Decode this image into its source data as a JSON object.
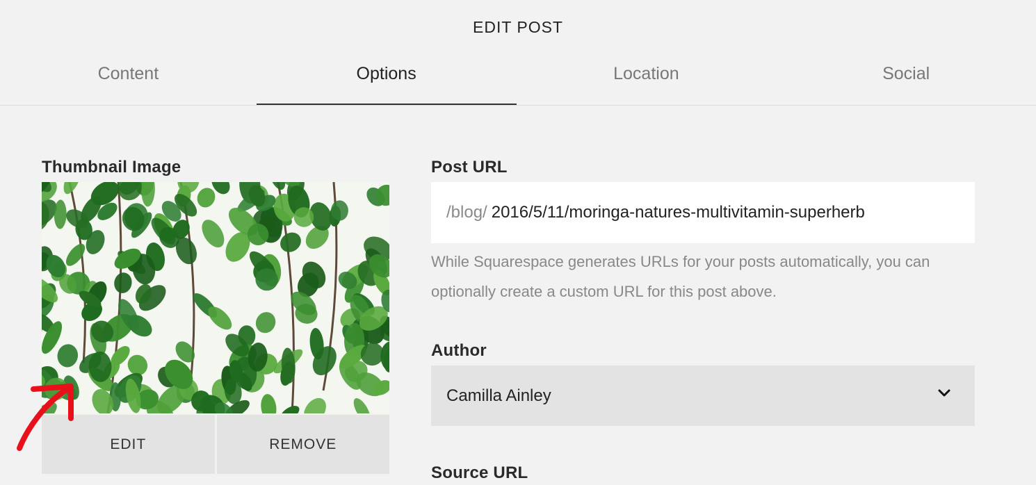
{
  "header": {
    "title": "EDIT POST"
  },
  "tabs": [
    {
      "label": "Content"
    },
    {
      "label": "Options"
    },
    {
      "label": "Location"
    },
    {
      "label": "Social"
    }
  ],
  "active_tab": "Options",
  "thumbnail": {
    "label": "Thumbnail Image",
    "edit_label": "EDIT",
    "remove_label": "REMOVE"
  },
  "post_url": {
    "label": "Post URL",
    "prefix": "/blog/",
    "value": "2016/5/11/moringa-natures-multivitamin-superherb",
    "help": "While Squarespace generates URLs for your posts automatically, you can optionally create a custom URL for this post above."
  },
  "author": {
    "label": "Author",
    "selected": "Camilla Ainley"
  },
  "source_url": {
    "label": "Source URL"
  },
  "colors": {
    "background": "#f2f2f2",
    "annotation": "#e8101a",
    "leaf": "#2e7d32"
  }
}
